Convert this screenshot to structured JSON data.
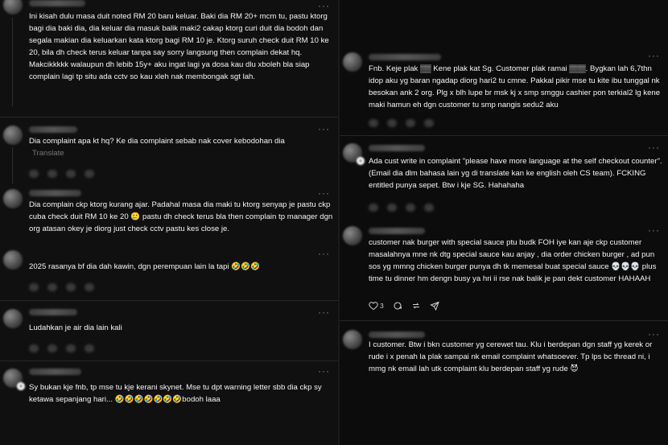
{
  "left_column": [
    {
      "text": "Ini kisah dulu masa duit noted RM 20 baru keluar. Baki dia RM 20+ mcm tu, pastu ktorg bagi dia baki dia, dia keluar dia masuk balik maki2 cakap ktorg curi duit dia bodoh dan segala makian dia keluarkan kata ktorg bagi RM 10 je. Ktorg suruh check duit RM 10 ke 20, bila dh check terus keluar tanpa say sorry langsung then complain dekat hq. Makcikkkkk walaupun dh lebib 15y+ aku ingat lagi ya dosa kau dlu xboleh bla siap complain lagi tp situ ada cctv so kau xleh nak membongak sgt lah."
    },
    {
      "text": "Dia complaint apa kt hq? Ke dia complaint sebab nak cover kebodohan dia",
      "translate": "Translate"
    },
    {
      "text": "Dia complain ckp ktorg kurang ajar. Padahal masa dia maki tu ktorg senyap je pastu ckp cuba check duit RM 10 ke 20 🥲 pastu dh check terus bla then complain tp manager dgn org atasan okey je diorg just check cctv pastu kes close je."
    },
    {
      "text": "2025 rasanya bf dia dah kawin, dgn perempuan lain la tapi 🤣🤣🤣"
    },
    {
      "text": "Ludahkan je air dia lain kali"
    },
    {
      "text": "Sy bukan kje fnb, tp mse tu kje kerani skynet. Mse tu dpt warning letter sbb dia ckp sy ketawa sepanjang hari... 🤣🤣🤣🤣🤣🤣🤣bodoh laaa"
    }
  ],
  "right_column": [
    {
      "text": "Fnb. Keje plak ▒▒ Kene plak kat Sg. Customer plak ramai ▒▒▒. Bygkan lah 6,7thn idop aku yg baran ngadap diorg hari2 tu cmne. Pakkal pikir mse tu kite ibu tunggal nk besokan ank 2 org. Plg x blh lupe br msk kj x smp smggu cashier pon terkial2 lg kene maki hamun eh dgn customer tu smp nangis sedu2 aku"
    },
    {
      "text": "Ada cust write in complaint \"please have more language at the self checkout counter\". (Email dia dlm bahasa lain yg di translate kan ke english oleh CS team). FCKING entitled punya sepet. Btw i kje SG. Hahahaha"
    },
    {
      "text": "customer nak burger with special sauce ptu budk FOH iye kan aje ckp customer masalahnya mne nk dtg special sauce kau anjay , dia order chicken burger , ad pun sos yg mmng chicken burger punya dh tk memesal buat special sauce 💀💀💀 plus time tu dinner hm dengn busy ya hri ii rse nak balik je pan dekt customer HAHAAH",
      "likes": "3"
    },
    {
      "text": "I customer. Btw i bkn customer yg cerewet tau. Klu i berdepan dgn staff yg kerek or rude i x penah la plak sampai nk email complaint whatsoever. Tp lps bc thread ni, i mmg nk email lah utk complaint klu berdepan staff yg rude 😈"
    }
  ],
  "icons": {
    "more": "more-horizontal-icon",
    "like": "heart-icon",
    "reply": "comment-icon",
    "repost": "repost-icon",
    "share": "share-icon"
  },
  "colors": {
    "background": "#101010",
    "text": "#f3f5f7",
    "muted": "#777777"
  }
}
